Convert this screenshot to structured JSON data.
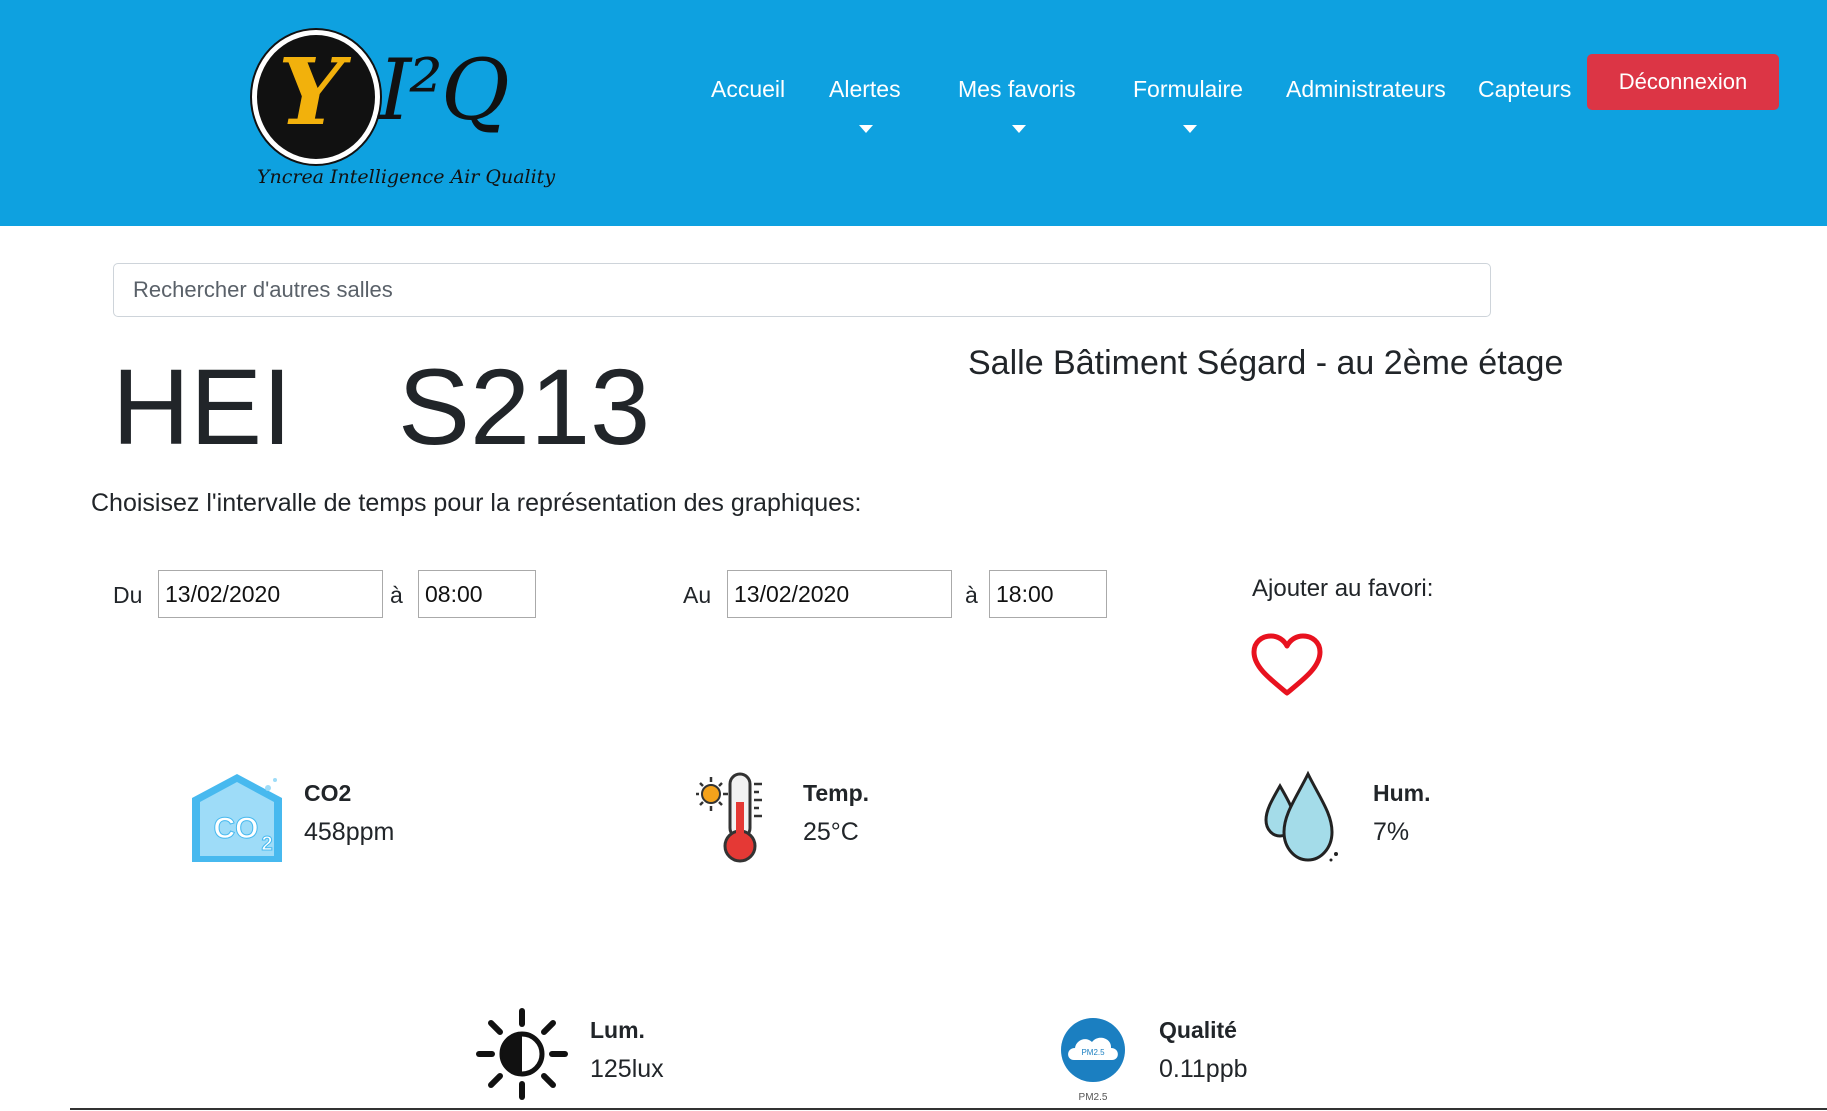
{
  "logo": {
    "letter": "Y",
    "brand": "I²Q",
    "tagline": "Yncrea Intelligence Air Quality"
  },
  "nav": {
    "home": "Accueil",
    "alerts": "Alertes",
    "favorites": "Mes favoris",
    "form": "Formulaire",
    "admins": "Administrateurs",
    "sensors": "Capteurs",
    "logout": "Déconnexion"
  },
  "search": {
    "placeholder": "Rechercher d'autres salles"
  },
  "room": {
    "building": "HEI",
    "number": "S213",
    "description": "Salle Bâtiment Ségard - au 2ème étage"
  },
  "interval": {
    "label": "Choisisez l'intervalle de temps pour la représentation des graphiques:",
    "from_label": "Du",
    "from_date": "13/02/2020",
    "at_label": "à",
    "from_time": "08:00",
    "to_label": "Au",
    "to_date": "13/02/2020",
    "to_time": "18:00"
  },
  "favorite": {
    "label": "Ajouter au favori:",
    "icon": "heart-outline-icon",
    "color": "#e8121f"
  },
  "measures": {
    "co2": {
      "name": "CO2",
      "value": "458ppm",
      "icon": "co2-icon",
      "icon_text": "CO2"
    },
    "temp": {
      "name": "Temp.",
      "value": "25°C",
      "icon": "thermometer-sun-icon"
    },
    "hum": {
      "name": "Hum.",
      "value": "7%",
      "icon": "water-drops-icon"
    },
    "lum": {
      "name": "Lum.",
      "value": "125lux",
      "icon": "sun-brightness-icon"
    },
    "quality": {
      "name": "Qualité",
      "value": "0.11ppb",
      "icon": "pm25-cloud-icon",
      "icon_text": "PM2.5"
    }
  },
  "colors": {
    "header_bg": "#0ea1e0",
    "logout_bg": "#dc3545",
    "text": "#212529"
  }
}
